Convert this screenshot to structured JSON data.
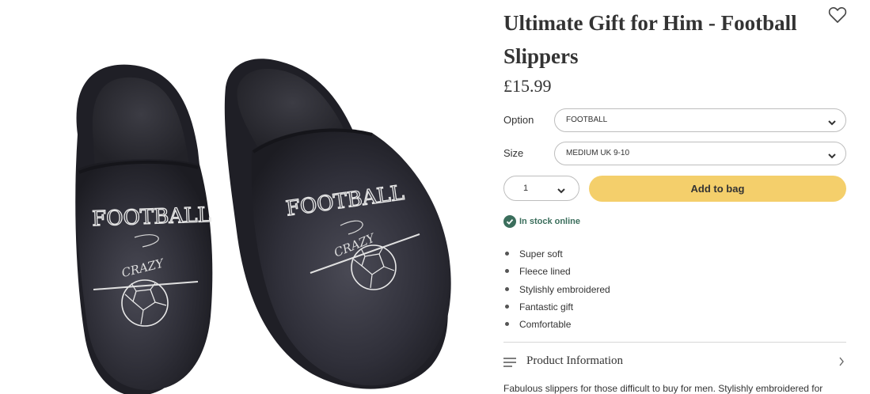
{
  "product": {
    "title": "Ultimate Gift for Him - Football Slippers",
    "price": "£15.99",
    "image_alt": "Black velvet football slippers embroidered with Football Crazy"
  },
  "options": {
    "option_label": "Option",
    "option_value": "FOOTBALL",
    "size_label": "Size",
    "size_value": "MEDIUM UK 9-10"
  },
  "purchase": {
    "quantity": "1",
    "add_to_bag_label": "Add to bag"
  },
  "stock": {
    "status": "In stock online",
    "color": "#3b6e5c"
  },
  "features": [
    "Super soft",
    "Fleece lined",
    "Stylishly embroidered",
    "Fantastic gift",
    "Comfortable"
  ],
  "product_information": {
    "label": "Product Information",
    "description": "Fabulous slippers for those difficult to buy for men. Stylishly embroidered for"
  },
  "embroidery": {
    "main_text": "FOOTBALL",
    "sub_text": "CRAZY"
  },
  "colors": {
    "accent": "#f4cf6b",
    "text": "#333333",
    "border": "#bdbdbd"
  },
  "icons": {
    "wishlist": "heart-icon",
    "dropdown": "chevron-down-icon",
    "stock": "check-circle-icon",
    "accordion": "menu-lines-icon",
    "accordion_arrow": "chevron-right-icon"
  }
}
